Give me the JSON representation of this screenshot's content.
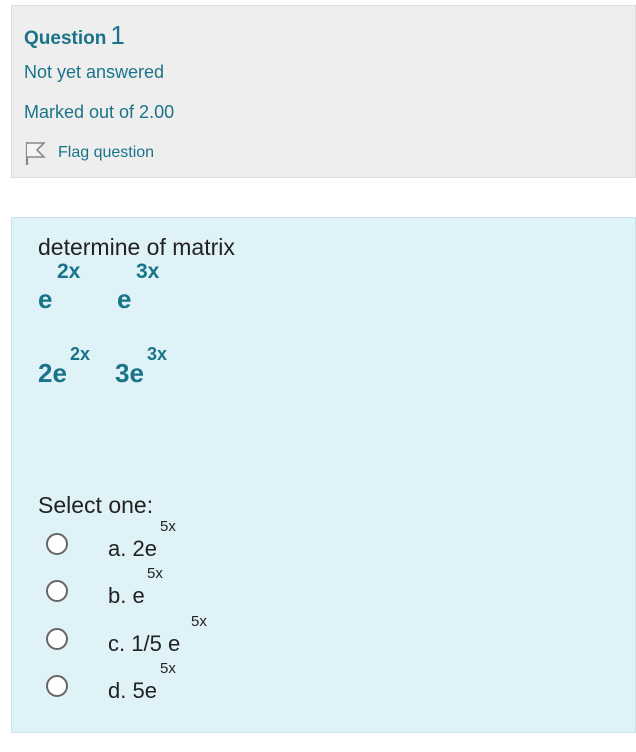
{
  "info": {
    "question_label": "Question",
    "question_number": "1",
    "state": "Not yet answered",
    "grade": "Marked out of 2.00",
    "flag_label": "Flag question"
  },
  "question": {
    "text": "determine of  matrix",
    "matrix": [
      [
        {
          "base": "e",
          "exp": "2x"
        },
        {
          "base": "e",
          "exp": "3x"
        }
      ],
      [
        {
          "base": "2e",
          "exp": "2x"
        },
        {
          "base": "3e",
          "exp": "3x"
        }
      ]
    ]
  },
  "answer": {
    "prompt": "Select one:",
    "options": [
      {
        "letter": "a.",
        "text": "2e",
        "exp": "5x"
      },
      {
        "letter": "b.",
        "text": "e",
        "exp": "5x"
      },
      {
        "letter": "c.",
        "text": "1/5 e",
        "exp": "5x"
      },
      {
        "letter": "d.",
        "text": "5e",
        "exp": "5x"
      }
    ]
  },
  "colors": {
    "accent": "#1a7488",
    "info_bg": "#eeeeee",
    "content_bg": "#def2f8"
  }
}
